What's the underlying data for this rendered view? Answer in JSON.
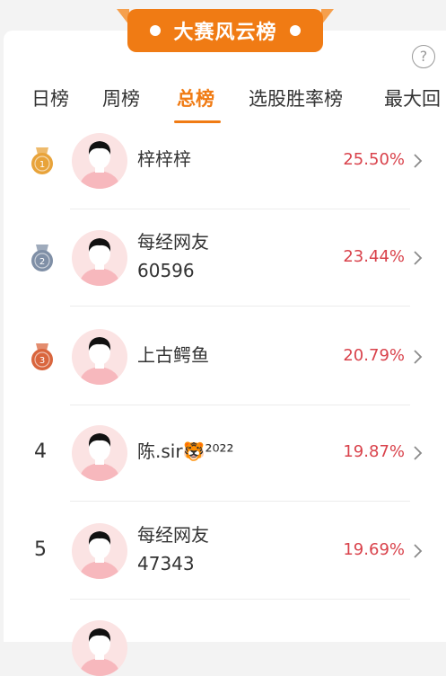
{
  "header": {
    "title": "大赛风云榜",
    "help_glyph": "?"
  },
  "tabs": [
    {
      "label": "日榜"
    },
    {
      "label": "周榜"
    },
    {
      "label": "总榜"
    },
    {
      "label": "选股胜率榜"
    },
    {
      "label": "最大回"
    }
  ],
  "active_tab": "总榜",
  "rows": [
    {
      "rank": "1",
      "name_line1": "梓梓梓",
      "name_line2": "",
      "pct": "25.50%",
      "medal": "gold"
    },
    {
      "rank": "2",
      "name_line1": "每经网友",
      "name_line2": "60596",
      "pct": "23.44%",
      "medal": "silver"
    },
    {
      "rank": "3",
      "name_line1": "上古鳄鱼",
      "name_line2": "",
      "pct": "20.79%",
      "medal": "bronze"
    },
    {
      "rank": "4",
      "name_line1": "陈.sir🐯²⁰²²",
      "name_line2": "",
      "pct": "19.87%",
      "medal": ""
    },
    {
      "rank": "5",
      "name_line1": "每经网友",
      "name_line2": "47343",
      "pct": "19.69%",
      "medal": ""
    }
  ],
  "colors": {
    "accent": "#f07b14",
    "pct": "#d9424b",
    "gold": "#e8a33a",
    "silver": "#7f8fa6",
    "bronze": "#d9653d"
  }
}
